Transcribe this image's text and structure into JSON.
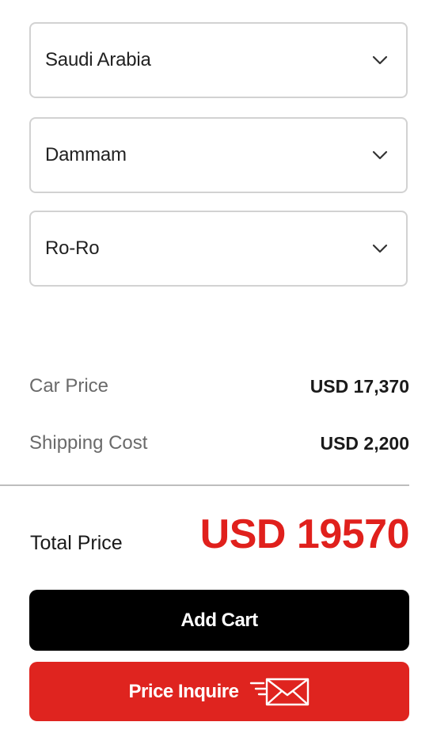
{
  "selects": {
    "country": {
      "value": "Saudi Arabia",
      "icon": "chevron-down-icon"
    },
    "port": {
      "value": "Dammam",
      "icon": "chevron-down-icon"
    },
    "shipping_method": {
      "value": "Ro-Ro",
      "icon": "chevron-down-icon"
    }
  },
  "summary": {
    "car_price_label": "Car Price",
    "car_price_value": "USD 17,370",
    "shipping_cost_label": "Shipping Cost",
    "shipping_cost_value": "USD 2,200",
    "total_label": "Total Price",
    "total_value": "USD 19570"
  },
  "buttons": {
    "add_cart_label": "Add Cart",
    "price_inquire_label": "Price Inquire",
    "price_inquire_icon": "mail-send-icon"
  },
  "colors": {
    "accent_red": "#e0201c",
    "button_black": "#000000",
    "button_red": "#df241f"
  }
}
